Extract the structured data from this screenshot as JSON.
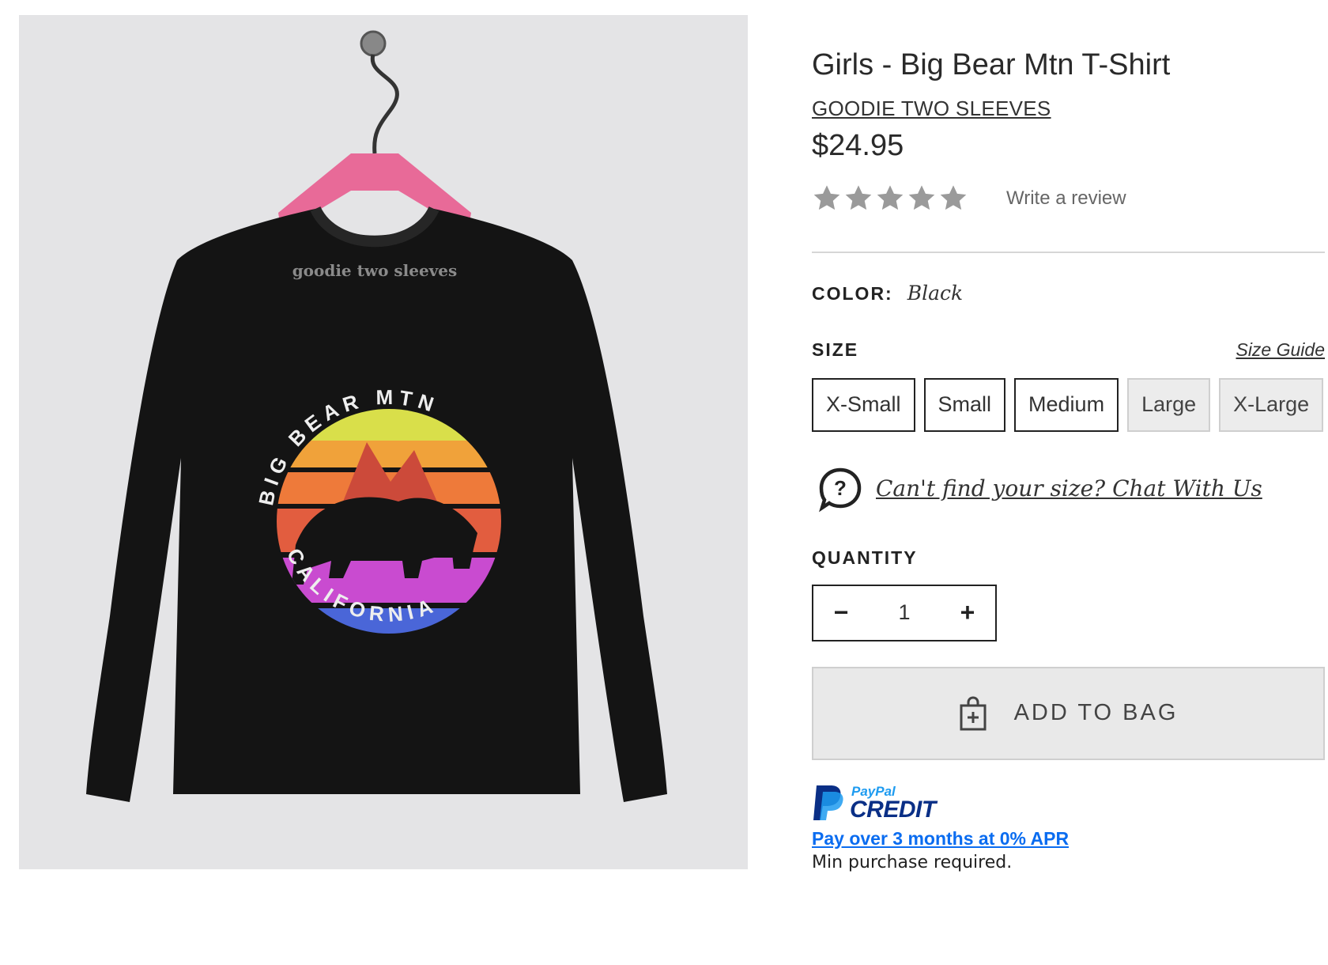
{
  "product": {
    "title": "Girls - Big Bear Mtn T-Shirt",
    "brand": "GOODIE TWO SLEEVES",
    "price": "$24.95",
    "rating_stars": 5,
    "review_link": "Write a review"
  },
  "image": {
    "label_logo": "goodie two sleeves",
    "graphic_top": "BIG BEAR MTN",
    "graphic_bottom": "CALIFORNIA"
  },
  "color": {
    "label": "COLOR:",
    "value": "Black"
  },
  "size": {
    "label": "SIZE",
    "guide": "Size Guide",
    "options": [
      "X-Small",
      "Small",
      "Medium",
      "Large",
      "X-Large"
    ],
    "unavailable": [
      "Large",
      "X-Large"
    ]
  },
  "chat": {
    "text": "Can't find your size? Chat With Us"
  },
  "quantity": {
    "label": "QUANTITY",
    "value": "1",
    "minus": "−",
    "plus": "+"
  },
  "cart": {
    "add_label": "ADD TO BAG"
  },
  "paypal": {
    "brand": "PayPal",
    "credit": "CREDIT",
    "offer": "Pay over 3 months at 0% APR",
    "note": "Min purchase required."
  },
  "colors": {
    "star": "#9a9a9a",
    "paypal_dark": "#0a2f86",
    "paypal_light": "#1d9bf0",
    "link_blue": "#0a6cf0"
  }
}
